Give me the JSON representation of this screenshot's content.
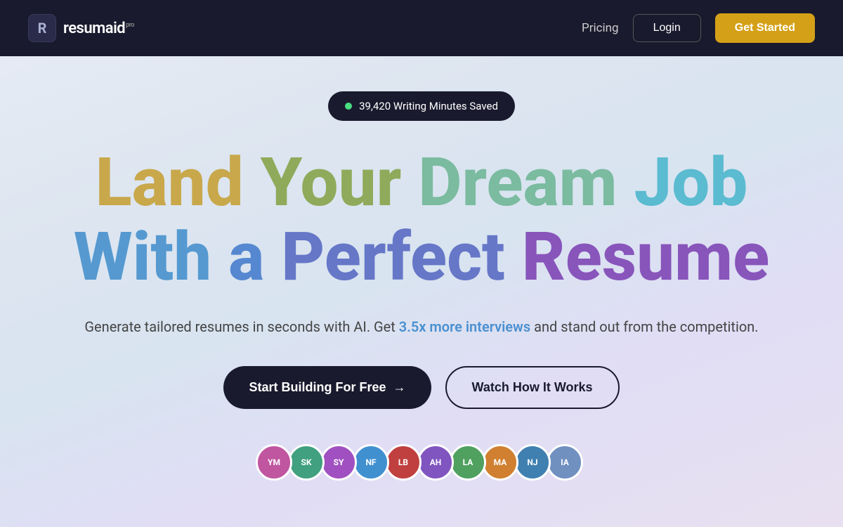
{
  "nav": {
    "logo_letter": "R",
    "logo_name": "resum",
    "logo_name2": "aid",
    "logo_beta": "pro",
    "pricing_label": "Pricing",
    "login_label": "Login",
    "get_started_label": "Get Started"
  },
  "hero": {
    "stats_text": "39,420 Writing Minutes Saved",
    "line1": {
      "land": "Land",
      "your": "Your",
      "dream": "Dream",
      "job": "Job"
    },
    "line2": {
      "with": "With",
      "a": "a",
      "perfect": "Perfect",
      "resume": "Resume"
    },
    "subtitle_start": "Generate tailored resumes in seconds with AI. Get ",
    "subtitle_highlight": "3.5x more interviews",
    "subtitle_end": " and stand out from the competition.",
    "cta_primary": "Start Building For Free",
    "cta_arrow": "→",
    "cta_secondary": "Watch How It Works"
  },
  "avatars": [
    {
      "initials": "YM",
      "color": "#c055a0"
    },
    {
      "initials": "SK",
      "color": "#40a080"
    },
    {
      "initials": "SY",
      "color": "#a050c0"
    },
    {
      "initials": "NF",
      "color": "#4090d0"
    },
    {
      "initials": "LB",
      "color": "#c04040"
    },
    {
      "initials": "AH",
      "color": "#8055c0"
    },
    {
      "initials": "LA",
      "color": "#50a060"
    },
    {
      "initials": "MA",
      "color": "#d08030"
    },
    {
      "initials": "NJ",
      "color": "#4080b0"
    },
    {
      "initials": "IA",
      "color": "#7090c0"
    }
  ]
}
